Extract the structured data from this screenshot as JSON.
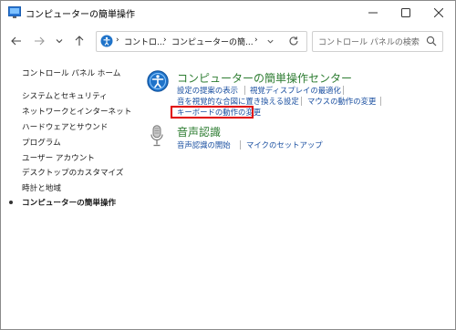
{
  "window": {
    "title": "コンピューターの簡単操作",
    "controls": {
      "minimize": "minimize-icon",
      "maximize": "maximize-icon",
      "close": "close-icon"
    }
  },
  "nav": {
    "icons": [
      "arrow-left-icon",
      "arrow-right-icon",
      "chevron-down-icon",
      "arrow-up-icon"
    ],
    "breadcrumb": [
      "コントロ...",
      "コンピューターの簡...",
      ""
    ],
    "search_placeholder": "コントロール パネルの検索"
  },
  "sidebar": {
    "items": [
      {
        "label": "コントロール パネル ホーム"
      },
      {
        "label": "システムとセキュリティ"
      },
      {
        "label": "ネットワークとインターネット"
      },
      {
        "label": "ハードウェアとサウンド"
      },
      {
        "label": "プログラム"
      },
      {
        "label": "ユーザー アカウント"
      },
      {
        "label": "デスクトップのカスタマイズ"
      },
      {
        "label": "時計と地域"
      },
      {
        "label": "コンピューターの簡単操作"
      }
    ]
  },
  "sections": [
    {
      "title": "コンピューターの簡単操作センター",
      "links": [
        "設定の提案の表示",
        "視覚ディスプレイの最適化",
        "音を視覚的な合図に置き換える設定",
        "マウスの動作の変更",
        "キーボードの動作の変更"
      ]
    },
    {
      "title": "音声認識",
      "links": [
        "音声認識の開始",
        "マイクのセットアップ"
      ]
    }
  ],
  "colors": {
    "heading": "#2e7d32",
    "link": "#1a4fa0",
    "highlight": "#e00000"
  }
}
